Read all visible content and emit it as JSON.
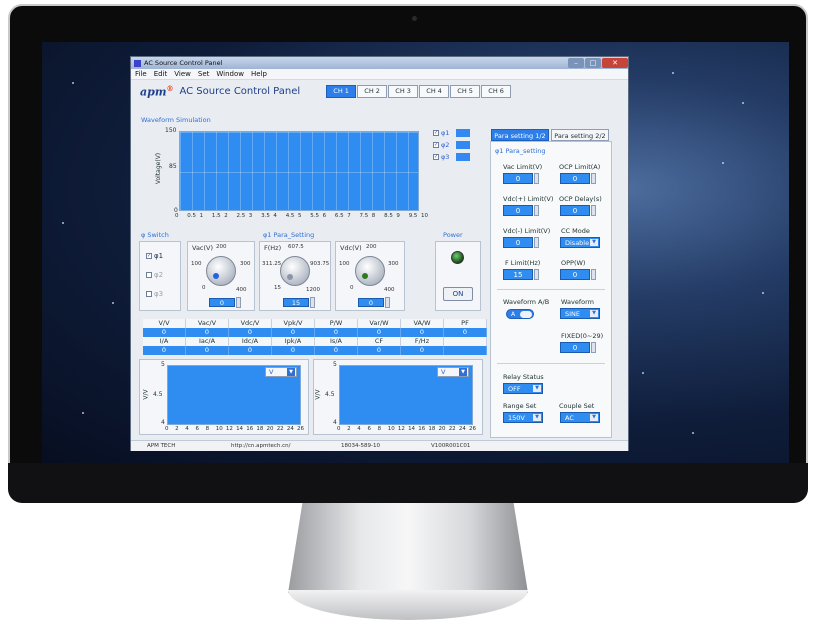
{
  "window": {
    "title": "AC Source Control Panel",
    "min": "–",
    "max": "□",
    "close": "✕"
  },
  "menu": [
    "File",
    "Edit",
    "View",
    "Set",
    "Window",
    "Help"
  ],
  "header": {
    "logo": "apm",
    "logo_mark": "®",
    "title": "AC Source Control Panel",
    "channels": [
      "CH 1",
      "CH 2",
      "CH 3",
      "CH 4",
      "CH 5",
      "CH 6"
    ]
  },
  "waveform": {
    "title": "Waveform Simulation",
    "ylabel": "Voltage(V)",
    "y_ticks": [
      "150",
      "85",
      "0"
    ],
    "x_ticks": [
      "0",
      "0.5",
      "1",
      "1.5",
      "2",
      "2.5",
      "3",
      "3.5",
      "4",
      "4.5",
      "5",
      "5.5",
      "6",
      "6.5",
      "7",
      "7.5",
      "8",
      "8.5",
      "9",
      "9.5",
      "10"
    ],
    "phases": [
      {
        "label": "φ1",
        "checked": "✓"
      },
      {
        "label": "φ2",
        "checked": "✓"
      },
      {
        "label": "φ3",
        "checked": "✓"
      }
    ]
  },
  "phi_switch": {
    "title": "φ Switch",
    "items": [
      {
        "label": "φ1",
        "checked": "✓"
      },
      {
        "label": "φ2",
        "checked": ""
      },
      {
        "label": "φ3",
        "checked": ""
      }
    ]
  },
  "para_setting": {
    "title": "φ1 Para_Setting",
    "knobs": [
      {
        "label": "Vac(V)",
        "top": "200",
        "left": "100",
        "right": "300",
        "min": "0",
        "max": "400",
        "value": "0"
      },
      {
        "label": "F(Hz)",
        "top": "607.5",
        "left": "311.25",
        "right": "903.75",
        "min": "15",
        "max": "1200",
        "value": "15"
      },
      {
        "label": "Vdc(V)",
        "top": "200",
        "left": "100",
        "right": "300",
        "min": "0",
        "max": "400",
        "value": "0"
      }
    ]
  },
  "power": {
    "title": "Power",
    "button": "ON"
  },
  "meas": {
    "row1_head": [
      "V/V",
      "Vac/V",
      "Vdc/V",
      "Vpk/V",
      "P/W",
      "Var/W",
      "VA/W",
      "PF"
    ],
    "row1_val": [
      "0",
      "0",
      "0",
      "0",
      "0",
      "0",
      "0",
      "0"
    ],
    "row2_head": [
      "I/A",
      "Iac/A",
      "Idc/A",
      "Ipk/A",
      "Is/A",
      "CF",
      "F/Hz",
      ""
    ],
    "row2_val": [
      "0",
      "0",
      "0",
      "0",
      "0",
      "0",
      "0",
      ""
    ]
  },
  "mini_charts": {
    "y_ticks": [
      "5",
      "4.5",
      "4"
    ],
    "ylabel": "V/V",
    "x_ticks": [
      "0",
      "2",
      "4",
      "6",
      "8",
      "10",
      "12",
      "14",
      "16",
      "18",
      "20",
      "22",
      "24",
      "26"
    ],
    "left_select": "V",
    "right_select": "V"
  },
  "right_panel": {
    "tabs": [
      "Para setting 1/2",
      "Para setting 2/2"
    ],
    "title": "φ1 Para_setting",
    "fields": [
      {
        "label": "Vac Limit(V)",
        "value": "0"
      },
      {
        "label": "OCP Limit(A)",
        "value": "0"
      },
      {
        "label": "Vdc(+) Limit(V)",
        "value": "0"
      },
      {
        "label": "OCP Delay(s)",
        "value": "0"
      },
      {
        "label": "Vdc(-) Limit(V)",
        "value": "0"
      },
      {
        "label": "CC Mode",
        "value": "Disable"
      },
      {
        "label": "F Limit(Hz)",
        "value": "15"
      },
      {
        "label": "OPP(W)",
        "value": "0"
      }
    ],
    "waveform_ab": {
      "label": "Waveform A/B",
      "value": "A"
    },
    "waveform": {
      "label": "Waveform",
      "value": "SINE"
    },
    "fixed": {
      "label": "FIXED(0~29)",
      "value": "0"
    },
    "relay": {
      "label": "Relay Status",
      "value": "OFF"
    },
    "range": {
      "label": "Range Set",
      "value": "150V"
    },
    "couple": {
      "label": "Couple Set",
      "value": "AC"
    }
  },
  "status": [
    "APM TECH",
    "http://cn.apmtech.cn/",
    "18034-589-10",
    "V100R001C01"
  ],
  "side_arrow": "《"
}
